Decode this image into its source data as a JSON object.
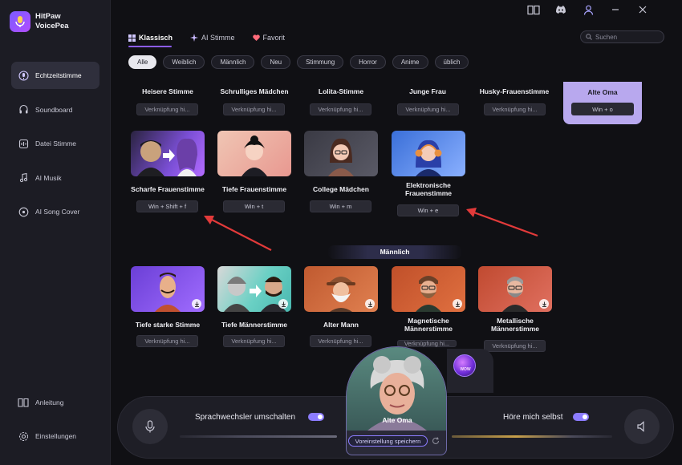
{
  "app": {
    "name_line1": "HitPaw",
    "name_line2": "VoicePea"
  },
  "sidebar": {
    "items": [
      {
        "label": "Echtzeitstimme",
        "active": true,
        "icon": "mic-wave-icon"
      },
      {
        "label": "Soundboard",
        "active": false,
        "icon": "headphones-icon"
      },
      {
        "label": "Datei Stimme",
        "active": false,
        "icon": "file-voice-icon"
      },
      {
        "label": "AI Musik",
        "active": false,
        "icon": "music-note-icon"
      },
      {
        "label": "AI Song Cover",
        "active": false,
        "icon": "vinyl-icon"
      }
    ],
    "bottom": [
      {
        "label": "Anleitung",
        "icon": "book-icon"
      },
      {
        "label": "Einstellungen",
        "icon": "gear-icon"
      }
    ]
  },
  "topbar": {
    "icons": [
      "book-open-icon",
      "discord-icon",
      "user-icon",
      "minimize-icon",
      "close-icon"
    ]
  },
  "tabs": [
    {
      "label": "Klassisch",
      "active": true
    },
    {
      "label": "AI Stimme",
      "active": false
    },
    {
      "label": "Favorit",
      "active": false
    }
  ],
  "search": {
    "placeholder": "Suchen"
  },
  "filters": [
    {
      "label": "Alle",
      "active": true
    },
    {
      "label": "Weiblich"
    },
    {
      "label": "Männlich"
    },
    {
      "label": "Neu"
    },
    {
      "label": "Stimmung"
    },
    {
      "label": "Horror"
    },
    {
      "label": "Anime"
    },
    {
      "label": "üblich"
    }
  ],
  "row1": [
    {
      "title": "Heisere Stimme",
      "shortcut": "Verknüpfung hi..."
    },
    {
      "title": "Schrulliges Mädchen",
      "shortcut": "Verknüpfung hi..."
    },
    {
      "title": "Lolita-Stimme",
      "shortcut": "Verknüpfung hi..."
    },
    {
      "title": "Junge Frau",
      "shortcut": "Verknüpfung hi..."
    },
    {
      "title": "Husky-Frauenstimme",
      "shortcut": "Verknüpfung hi..."
    },
    {
      "title": "Alte Oma",
      "shortcut": "Win + o"
    }
  ],
  "row2": [
    {
      "title": "Scharfe Frauenstimme",
      "shortcut": "Win + Shift + f"
    },
    {
      "title": "Tiefe Frauenstimme",
      "shortcut": "Win + t"
    },
    {
      "title": "College Mädchen",
      "shortcut": "Win + m"
    },
    {
      "title_line1": "Elektronische",
      "title_line2": "Frauenstimme",
      "shortcut": "Win + e"
    }
  ],
  "section_male": "Männlich",
  "row3": [
    {
      "title": "Tiefe starke Stimme",
      "shortcut": "Verknüpfung hi..."
    },
    {
      "title": "Tiefe Männerstimme",
      "shortcut": "Verknüpfung hi..."
    },
    {
      "title": "Alter Mann",
      "shortcut": "Verknüpfung hi..."
    },
    {
      "title_line1": "Magnetische",
      "title_line2": "Männerstimme",
      "shortcut": "Verknüpfung hi..."
    },
    {
      "title_line1": "Metallische",
      "title_line2": "Männerstimme",
      "shortcut": "Verknüpfung hi..."
    }
  ],
  "bottom": {
    "switch_label": "Sprachwechsler umschalten",
    "hear_label": "Höre mich selbst",
    "current_voice": "Alte Oma",
    "save_preset": "Voreinstellung speichern",
    "wow_badge": "WOW",
    "switch_on": true,
    "hear_on": true
  },
  "colors": {
    "accent": "#8c5cff",
    "selected_card": "#b8a8ee",
    "arrow": "#e23a3a"
  }
}
